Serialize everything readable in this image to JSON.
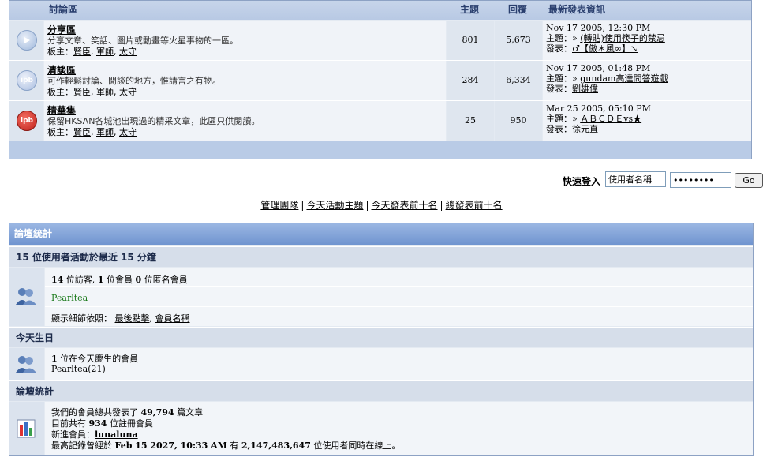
{
  "forum_table": {
    "headers": {
      "forum": "討論區",
      "topics": "主題",
      "replies": "回覆",
      "last_post": "最新發表資訊"
    },
    "rows": [
      {
        "name": "分享區",
        "description": "分享文章、笑話、圖片或動畫等火星事物的一區。",
        "mods_label": "板主：",
        "mods": [
          "賢臣",
          "軍師",
          "太守"
        ],
        "topics": "801",
        "replies": "5,673",
        "last_date": "Nov 17 2005, 12:30 PM",
        "topic_label": "主題：",
        "topic_prefix": "»",
        "topic_title": "(轉貼)使用筷子的禁忌",
        "poster_label": "發表：",
        "poster": "♂【傲＊風∞】↘",
        "icon": "forum-read-icon",
        "icon_color": "#9fb8dc"
      },
      {
        "name": "清談區",
        "description": "可作輕鬆討論、閒談的地方，惟請言之有物。",
        "mods_label": "板主：",
        "mods": [
          "賢臣",
          "軍師",
          "太守"
        ],
        "topics": "284",
        "replies": "6,334",
        "last_date": "Nov 17 2005, 01:48 PM",
        "topic_label": "主題：",
        "topic_prefix": "»",
        "topic_title": "gundam高達問答遊戲",
        "poster_label": "發表：",
        "poster": "劉雄偉",
        "icon": "ipb-read-icon",
        "icon_text": "ipb",
        "icon_color": "#a9bde0"
      },
      {
        "name": "精華集",
        "description": "保留HKSAN各城池出現過的精采文章，此區只供閱讀。",
        "mods_label": "板主：",
        "mods": [
          "賢臣",
          "軍師",
          "太守"
        ],
        "topics": "25",
        "replies": "950",
        "last_date": "Mar 25 2005, 05:10 PM",
        "topic_label": "主題：",
        "topic_prefix": "»",
        "topic_title": "ＡＢＣＤＥvs★",
        "poster_label": "發表：",
        "poster": "徐元直",
        "icon": "ipb-redirect-icon",
        "icon_text": "ipb",
        "icon_color": "#d9302a"
      }
    ]
  },
  "quick_login": {
    "label": "快速登入",
    "username_value": "使用者名稱",
    "password_value": "••••••••",
    "go_label": "Go"
  },
  "links": [
    "管理團隊",
    "今天活動主題",
    "今天發表前十名",
    "總發表前十名"
  ],
  "stats": {
    "title": "論壇統計",
    "active": {
      "header": "15 位使用者活動於最近 15 分鐘",
      "summary_guests": "14",
      "summary_guests_label": " 位訪客, ",
      "summary_members": "1",
      "summary_members_label": " 位會員 ",
      "summary_anon": "0",
      "summary_anon_label": " 位匿名會員",
      "online_user": "Pearltea",
      "sort_label": "顯示細節依照：",
      "sort_last_click": "最後點擊",
      "sort_member_name": "會員名稱"
    },
    "birthday": {
      "header": "今天生日",
      "count": "1",
      "count_label": " 位在今天慶生的會員",
      "member": "Pearltea",
      "age": "(21)"
    },
    "board": {
      "header": "論壇統計",
      "posts_prefix": "我們的會員總共發表了 ",
      "posts_count": "49,794",
      "posts_suffix": " 篇文章",
      "members_prefix": "目前共有 ",
      "members_count": "934",
      "members_suffix": " 位註冊會員",
      "newest_prefix": "新進會員：",
      "newest_member": "lunaluna",
      "record_prefix": "最高記錄曾經於 ",
      "record_date": "Feb 15 2027, 10:33 AM",
      "record_mid": " 有 ",
      "record_count": "2,147,483,647",
      "record_suffix": " 位使用者同時在線上。"
    }
  },
  "colors": {
    "header_bg": "#b8c9e4",
    "row_bg": "#f0f3f8",
    "stats_title_bg": "#6e93cf",
    "link_green": "#1b7a1b"
  }
}
